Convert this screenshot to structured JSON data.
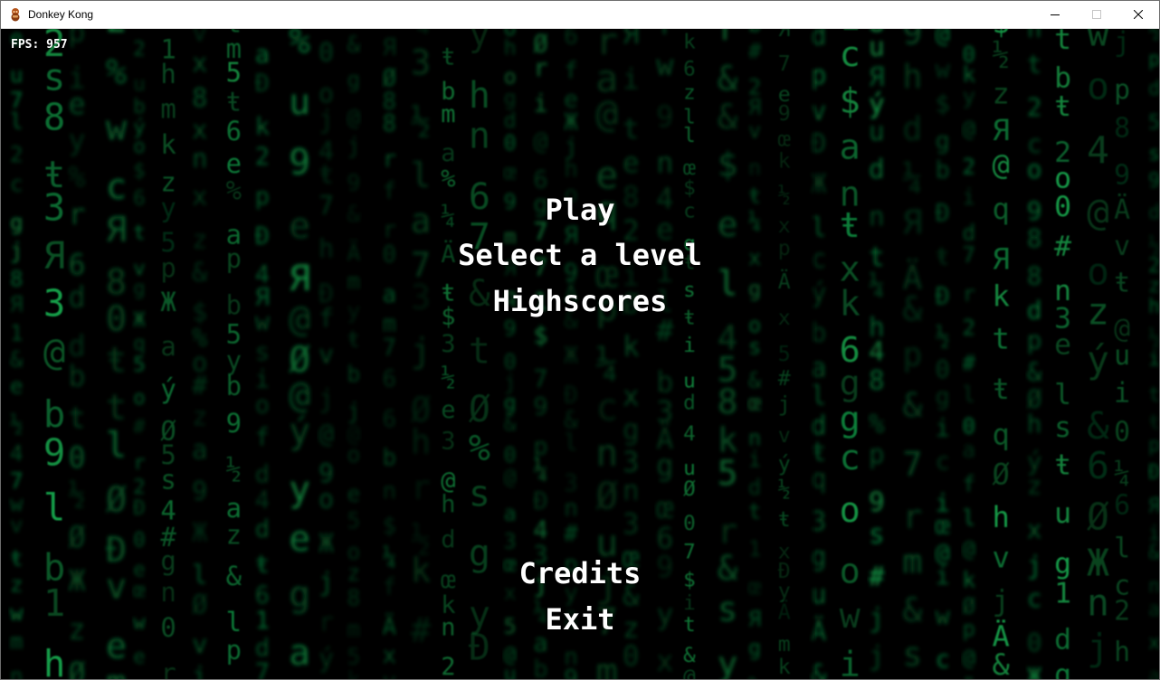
{
  "window": {
    "title": "Donkey Kong",
    "icon": "donkey-kong-icon",
    "controls": {
      "minimize": "minimize-icon",
      "maximize": "maximize-icon",
      "close": "close-icon"
    }
  },
  "hud": {
    "fps_label": "FPS:",
    "fps_value": "957"
  },
  "menu": {
    "play": "Play",
    "select_level": "Select a level",
    "highscores": "Highscores",
    "credits": "Credits",
    "exit": "Exit"
  },
  "background": {
    "style": "matrix-code-rain",
    "accent": "#19c35a",
    "base": "#000000"
  }
}
